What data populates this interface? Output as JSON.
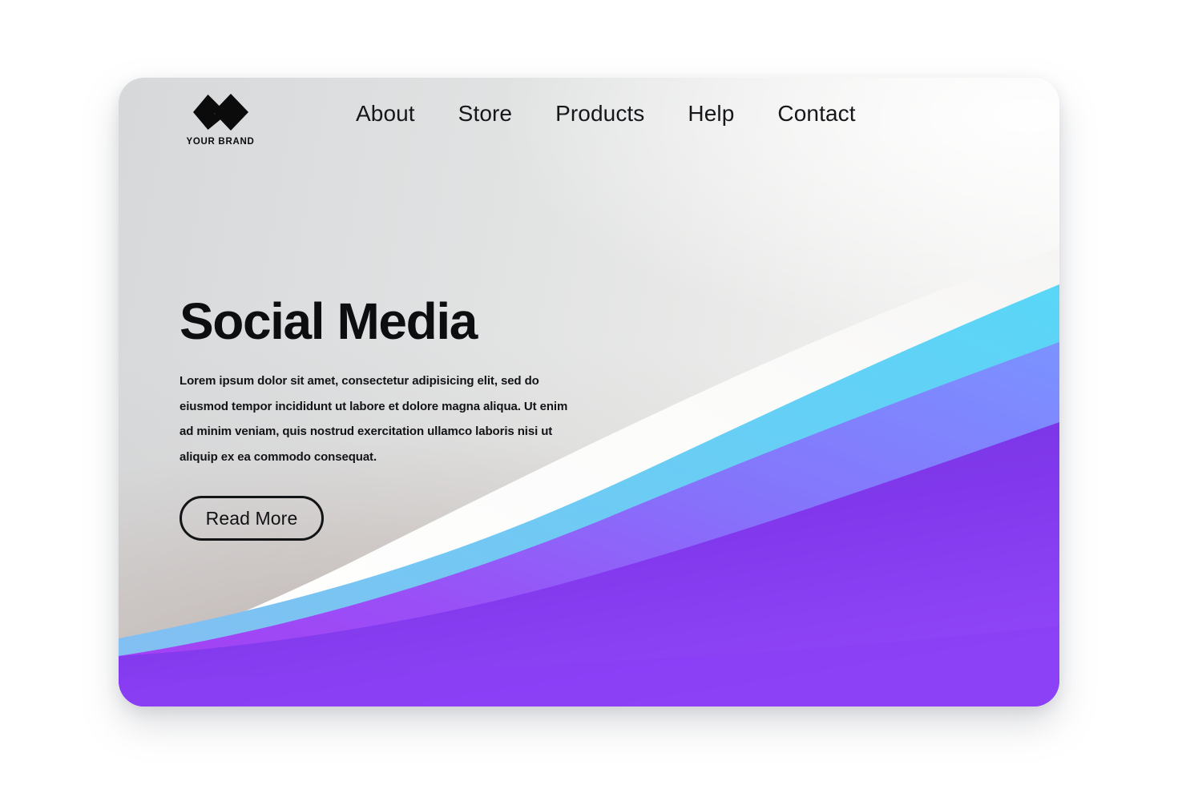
{
  "page": {
    "background_color": "#ffffff",
    "card": {
      "corner_radius": "32px",
      "gradient_from": "#d6d8da",
      "gradient_to": "#f7f7f6"
    }
  },
  "brand": {
    "name": "YOUR BRAND",
    "logo_icon": "double-diamond-icon",
    "logo_color": "#0b0b0c"
  },
  "nav": {
    "items": [
      {
        "label": "About"
      },
      {
        "label": "Store"
      },
      {
        "label": "Products"
      },
      {
        "label": "Help"
      },
      {
        "label": "Contact"
      }
    ]
  },
  "hero": {
    "title": "Social Media",
    "paragraph": "Lorem ipsum dolor sit amet, consectetur adipisicing elit, sed do eiusmod tempor incididunt ut labore et dolore magna aliqua. Ut enim ad minim veniam, quis nostrud exercitation ullamco laboris nisi ut aliquip ex ea commodo consequat.",
    "cta_label": "Read More"
  },
  "decoration": {
    "waves": [
      {
        "name": "white-band",
        "color": "#fbfbfa"
      },
      {
        "name": "cyan-band",
        "color_left": "#7fb9ef",
        "color_right": "#5fd2f4"
      },
      {
        "name": "violet-blue-band",
        "color_left": "#a13df0",
        "color_right": "#7b8cfb"
      },
      {
        "name": "deep-purple-base",
        "color_left": "#7a33e0",
        "color_right": "#8a3df3"
      },
      {
        "name": "indigo-wedge",
        "color": "#4a1dc2"
      }
    ]
  }
}
